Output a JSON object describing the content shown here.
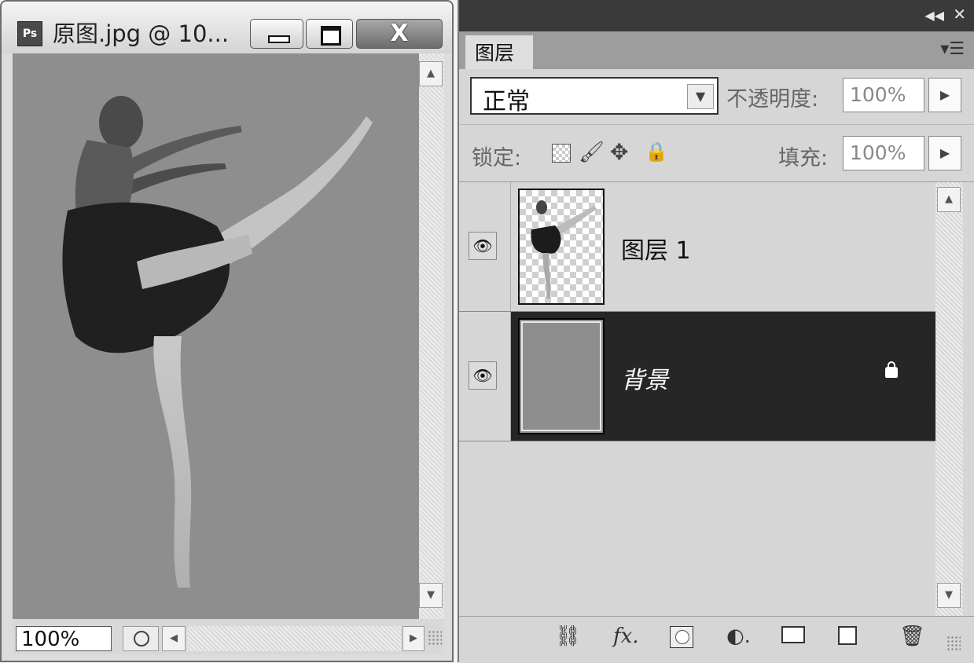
{
  "document": {
    "app_icon": "Ps",
    "title": "原图.jpg @ 10...",
    "zoom": "100%"
  },
  "layers_panel": {
    "tab": "图层",
    "blend_mode": "正常",
    "opacity_label": "不透明度:",
    "opacity_value": "100%",
    "lock_label": "锁定:",
    "fill_label": "填充:",
    "fill_value": "100%",
    "layers": [
      {
        "name": "图层 1",
        "visible": true,
        "selected": false
      },
      {
        "name": "背景",
        "visible": true,
        "selected": true,
        "locked": true
      }
    ]
  },
  "icons": {
    "bottom_bar": [
      "link-layers-icon",
      "fx-icon",
      "add-mask-icon",
      "adjustment-layer-icon",
      "new-group-icon",
      "new-layer-icon",
      "trash-icon"
    ]
  },
  "colors": {
    "canvas_bg": "#8e8e8e",
    "selected_layer_bg": "#262626",
    "panel_bg": "#d6d6d6"
  }
}
